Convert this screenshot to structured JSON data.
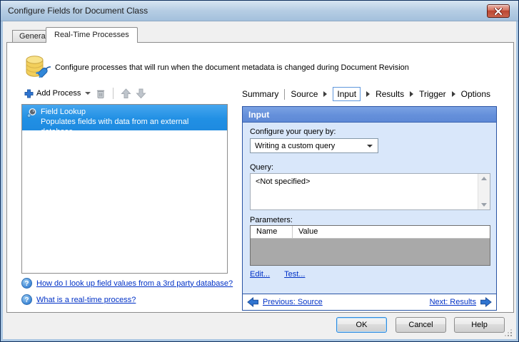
{
  "window": {
    "title": "Configure Fields for Document Class"
  },
  "tabs": {
    "general": "General",
    "realtime": "Real-Time Processes"
  },
  "intro": {
    "description": "Configure processes that will run when the document metadata is changed during Document Revision"
  },
  "toolbar": {
    "add_process": "Add Process"
  },
  "process_list": {
    "selected_item": {
      "title": "Field Lookup",
      "subtitle": "Populates fields with data from an external database."
    }
  },
  "help": {
    "link_database": "How do I look up field values from a 3rd party database?",
    "link_realtime": "What is a real-time process?"
  },
  "breadcrumb": {
    "items": [
      "Summary",
      "Source",
      "Input",
      "Results",
      "Trigger",
      "Options"
    ],
    "active": "Input"
  },
  "input_panel": {
    "header": "Input",
    "query_by_label": "Configure your query by:",
    "query_by_value": "Writing a custom query",
    "query_label": "Query:",
    "query_value": "<Not specified>",
    "parameters_label": "Parameters:",
    "columns": [
      "Name",
      "Value"
    ],
    "edit_link": "Edit...",
    "test_link": "Test...",
    "previous_link": "Previous: Source",
    "next_link": "Next: Results"
  },
  "footer": {
    "ok": "OK",
    "cancel": "Cancel",
    "help": "Help"
  },
  "colors": {
    "selection_blue": "#2190e4",
    "panel_header_blue": "#6590da",
    "panel_border_blue": "#2a54a4",
    "link_blue": "#0031c6",
    "close_button_red": "#bb4530",
    "titlebar_blue": "#b6cde4"
  }
}
